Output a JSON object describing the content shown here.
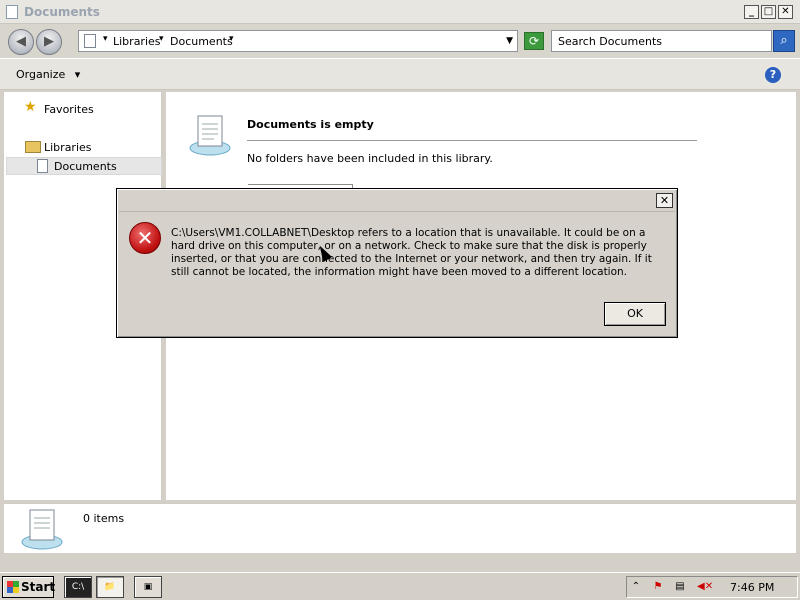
{
  "window": {
    "title": "Documents",
    "controls": {
      "minimize": "_",
      "maximize": "□",
      "close": "✕"
    }
  },
  "navbar": {
    "back_glyph": "◀",
    "forward_glyph": "▶",
    "breadcrumb": [
      "Libraries",
      "Documents"
    ],
    "search_placeholder": "Search Documents"
  },
  "toolbar": {
    "organize_label": "Organize",
    "organize_arrow": "▾",
    "help_glyph": "?"
  },
  "sidebar": {
    "items": [
      {
        "label": "Favorites",
        "icon": "star-icon"
      },
      {
        "label": "Libraries",
        "icon": "library-icon"
      },
      {
        "label": "Documents",
        "icon": "document-icon",
        "selected": true
      }
    ]
  },
  "main": {
    "empty_title": "Documents is empty",
    "empty_message": "No folders have been included in this library."
  },
  "details": {
    "item_count": "0 items"
  },
  "dialog": {
    "close_glyph": "✕",
    "message": "C:\\Users\\VM1.COLLABNET\\Desktop refers to a location that is unavailable. It could be on a hard drive on this computer, or on a network. Check to make sure that the disk is properly inserted, or that you are connected to the Internet or your network, and then try again. If it still cannot be located, the information might have been moved to a different location.",
    "ok_label": "OK",
    "icon": "error-icon"
  },
  "taskbar": {
    "start_label": "Start",
    "apps": [
      {
        "name": "command-prompt",
        "glyph": "C:\\"
      },
      {
        "name": "windows-explorer",
        "glyph": "📁",
        "active": true
      },
      {
        "name": "server-manager",
        "glyph": "▣"
      }
    ],
    "tray_icons": [
      "show-hidden-icons",
      "action-center-icon",
      "network-icon",
      "volume-muted-icon"
    ],
    "clock": "7:46 PM"
  },
  "colors": {
    "dialog_bg": "#d6d2cb",
    "error_red": "#c01010",
    "title_inactive": "#9aa3b0",
    "search_blue": "#2f68c0"
  }
}
